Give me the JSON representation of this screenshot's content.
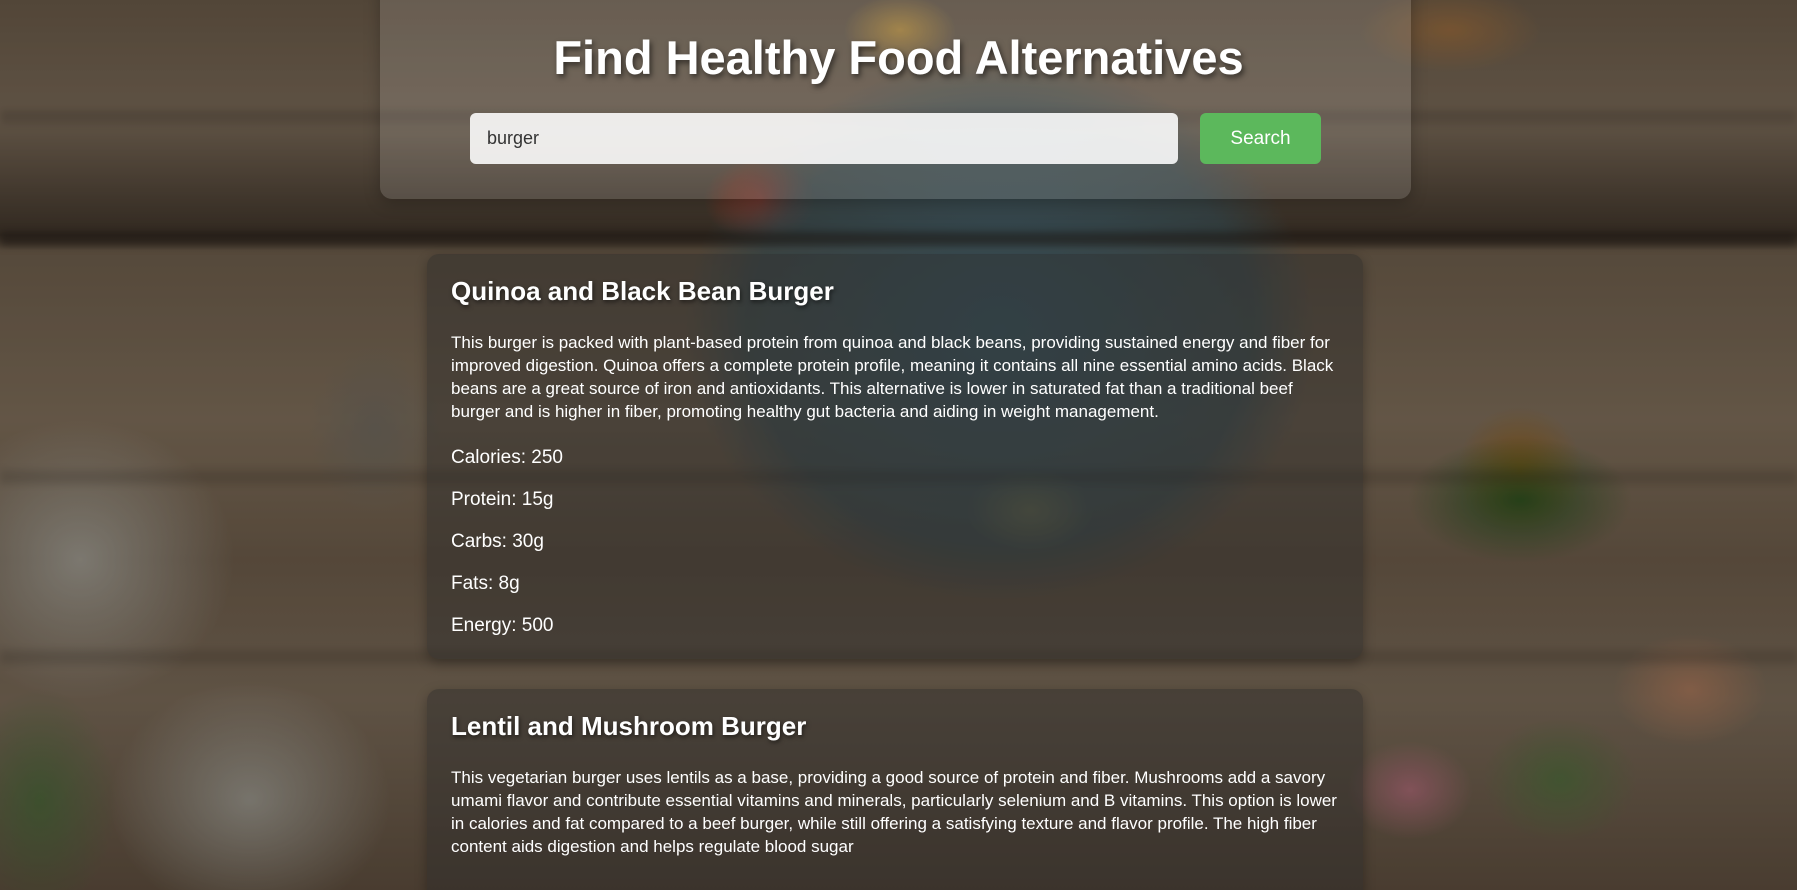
{
  "header": {
    "title": "Find Healthy Food Alternatives",
    "search_value": "burger",
    "search_button": "Search"
  },
  "results": [
    {
      "name": "Quinoa and Black Bean Burger",
      "description": "This burger is packed with plant-based protein from quinoa and black beans, providing sustained energy and fiber for improved digestion. Quinoa offers a complete protein profile, meaning it contains all nine essential amino acids. Black beans are a great source of iron and antioxidants. This alternative is lower in saturated fat than a traditional beef burger and is higher in fiber, promoting healthy gut bacteria and aiding in weight management.",
      "calories": "Calories: 250",
      "protein": "Protein: 15g",
      "carbs": "Carbs: 30g",
      "fats": "Fats: 8g",
      "energy": "Energy: 500"
    },
    {
      "name": "Lentil and Mushroom Burger",
      "description": "This vegetarian burger uses lentils as a base, providing a good source of protein and fiber. Mushrooms add a savory umami flavor and contribute essential vitamins and minerals, particularly selenium and B vitamins. This option is lower in calories and fat compared to a beef burger, while still offering a satisfying texture and flavor profile. The high fiber content aids digestion and helps regulate blood sugar"
    }
  ],
  "colors": {
    "search_button": "#5cb85c",
    "text": "#ffffff"
  }
}
